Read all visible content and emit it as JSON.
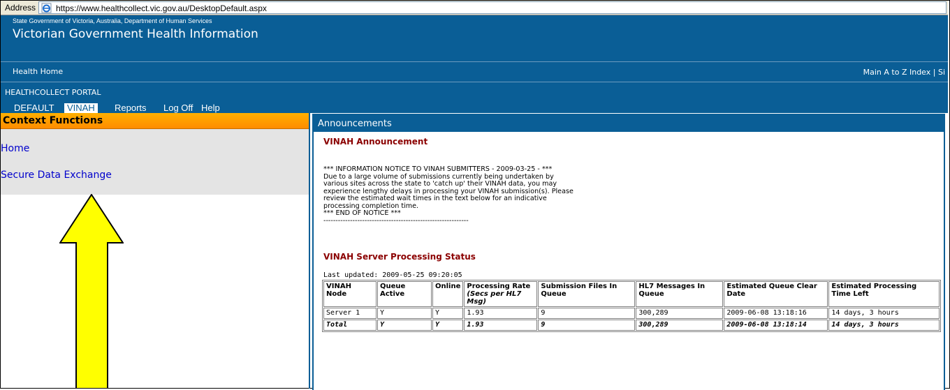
{
  "address_bar": {
    "label": "Address",
    "url": "https://www.healthcollect.vic.gov.au/DesktopDefault.aspx"
  },
  "header": {
    "subtitle": "State Government of Victoria, Australia, Department of Human Services",
    "title": "Victorian Government Health Information"
  },
  "nav": {
    "home_link": "Health Home",
    "right_links": "Main A to Z Index | Si"
  },
  "portal": {
    "title": "HEALTHCOLLECT PORTAL"
  },
  "tabs": {
    "default": "DEFAULT",
    "vinah": "VINAH",
    "reports": "Reports",
    "logoff": "Log Off",
    "help": "Help"
  },
  "context": {
    "title": "Context Functions",
    "home": "Home",
    "secure": "Secure Data Exchange"
  },
  "announcements": {
    "header": "Announcements",
    "subtitle": "VINAH Announcement",
    "notice": "*** INFORMATION NOTICE TO VINAH SUBMITTERS - 2009-03-25 - ***\nDue to a large volume of submissions currently being undertaken by\nvarious sites across the state to 'catch up' their VINAH data, you may\nexperience lengthy delays in processing your VINAH submission(s). Please\nreview the estimated wait times in the text below for an indicative\nprocessing completion time.\n*** END OF NOTICE ***\n------------------------------------------------------------",
    "status_title": "VINAH Server Processing Status",
    "last_updated": "Last updated: 2009-05-25 09:20:05"
  },
  "table": {
    "headers": {
      "node": "VINAH Node",
      "queue_active": "Queue Active",
      "online": "Online",
      "rate": "Processing Rate",
      "rate_unit": "(Secs per HL7 Msg)",
      "files": "Submission Files In Queue",
      "hl7": "HL7 Messages In Queue",
      "clear_date": "Estimated Queue Clear Date",
      "time_left": "Estimated Processing Time Left"
    },
    "rows": [
      {
        "node": "Server 1",
        "queue_active": "Y",
        "online": "Y",
        "rate": "1.93",
        "files": "9",
        "hl7": "300,289",
        "clear_date": "2009-06-08 13:18:16",
        "time_left": "14 days, 3 hours"
      },
      {
        "node": "Total",
        "queue_active": "Y",
        "online": "Y",
        "rate": "1.93",
        "files": "9",
        "hl7": "300,289",
        "clear_date": "2009-06-08 13:18:14",
        "time_left": "14 days, 3 hours"
      }
    ]
  },
  "colors": {
    "brand_blue": "#0a5e96",
    "context_orange": "#ff9900",
    "heading_red": "#8b0000",
    "arrow_yellow": "#ffff00"
  },
  "icons": {
    "browser": "ie-page-icon",
    "annotation": "up-arrow-annotation"
  }
}
